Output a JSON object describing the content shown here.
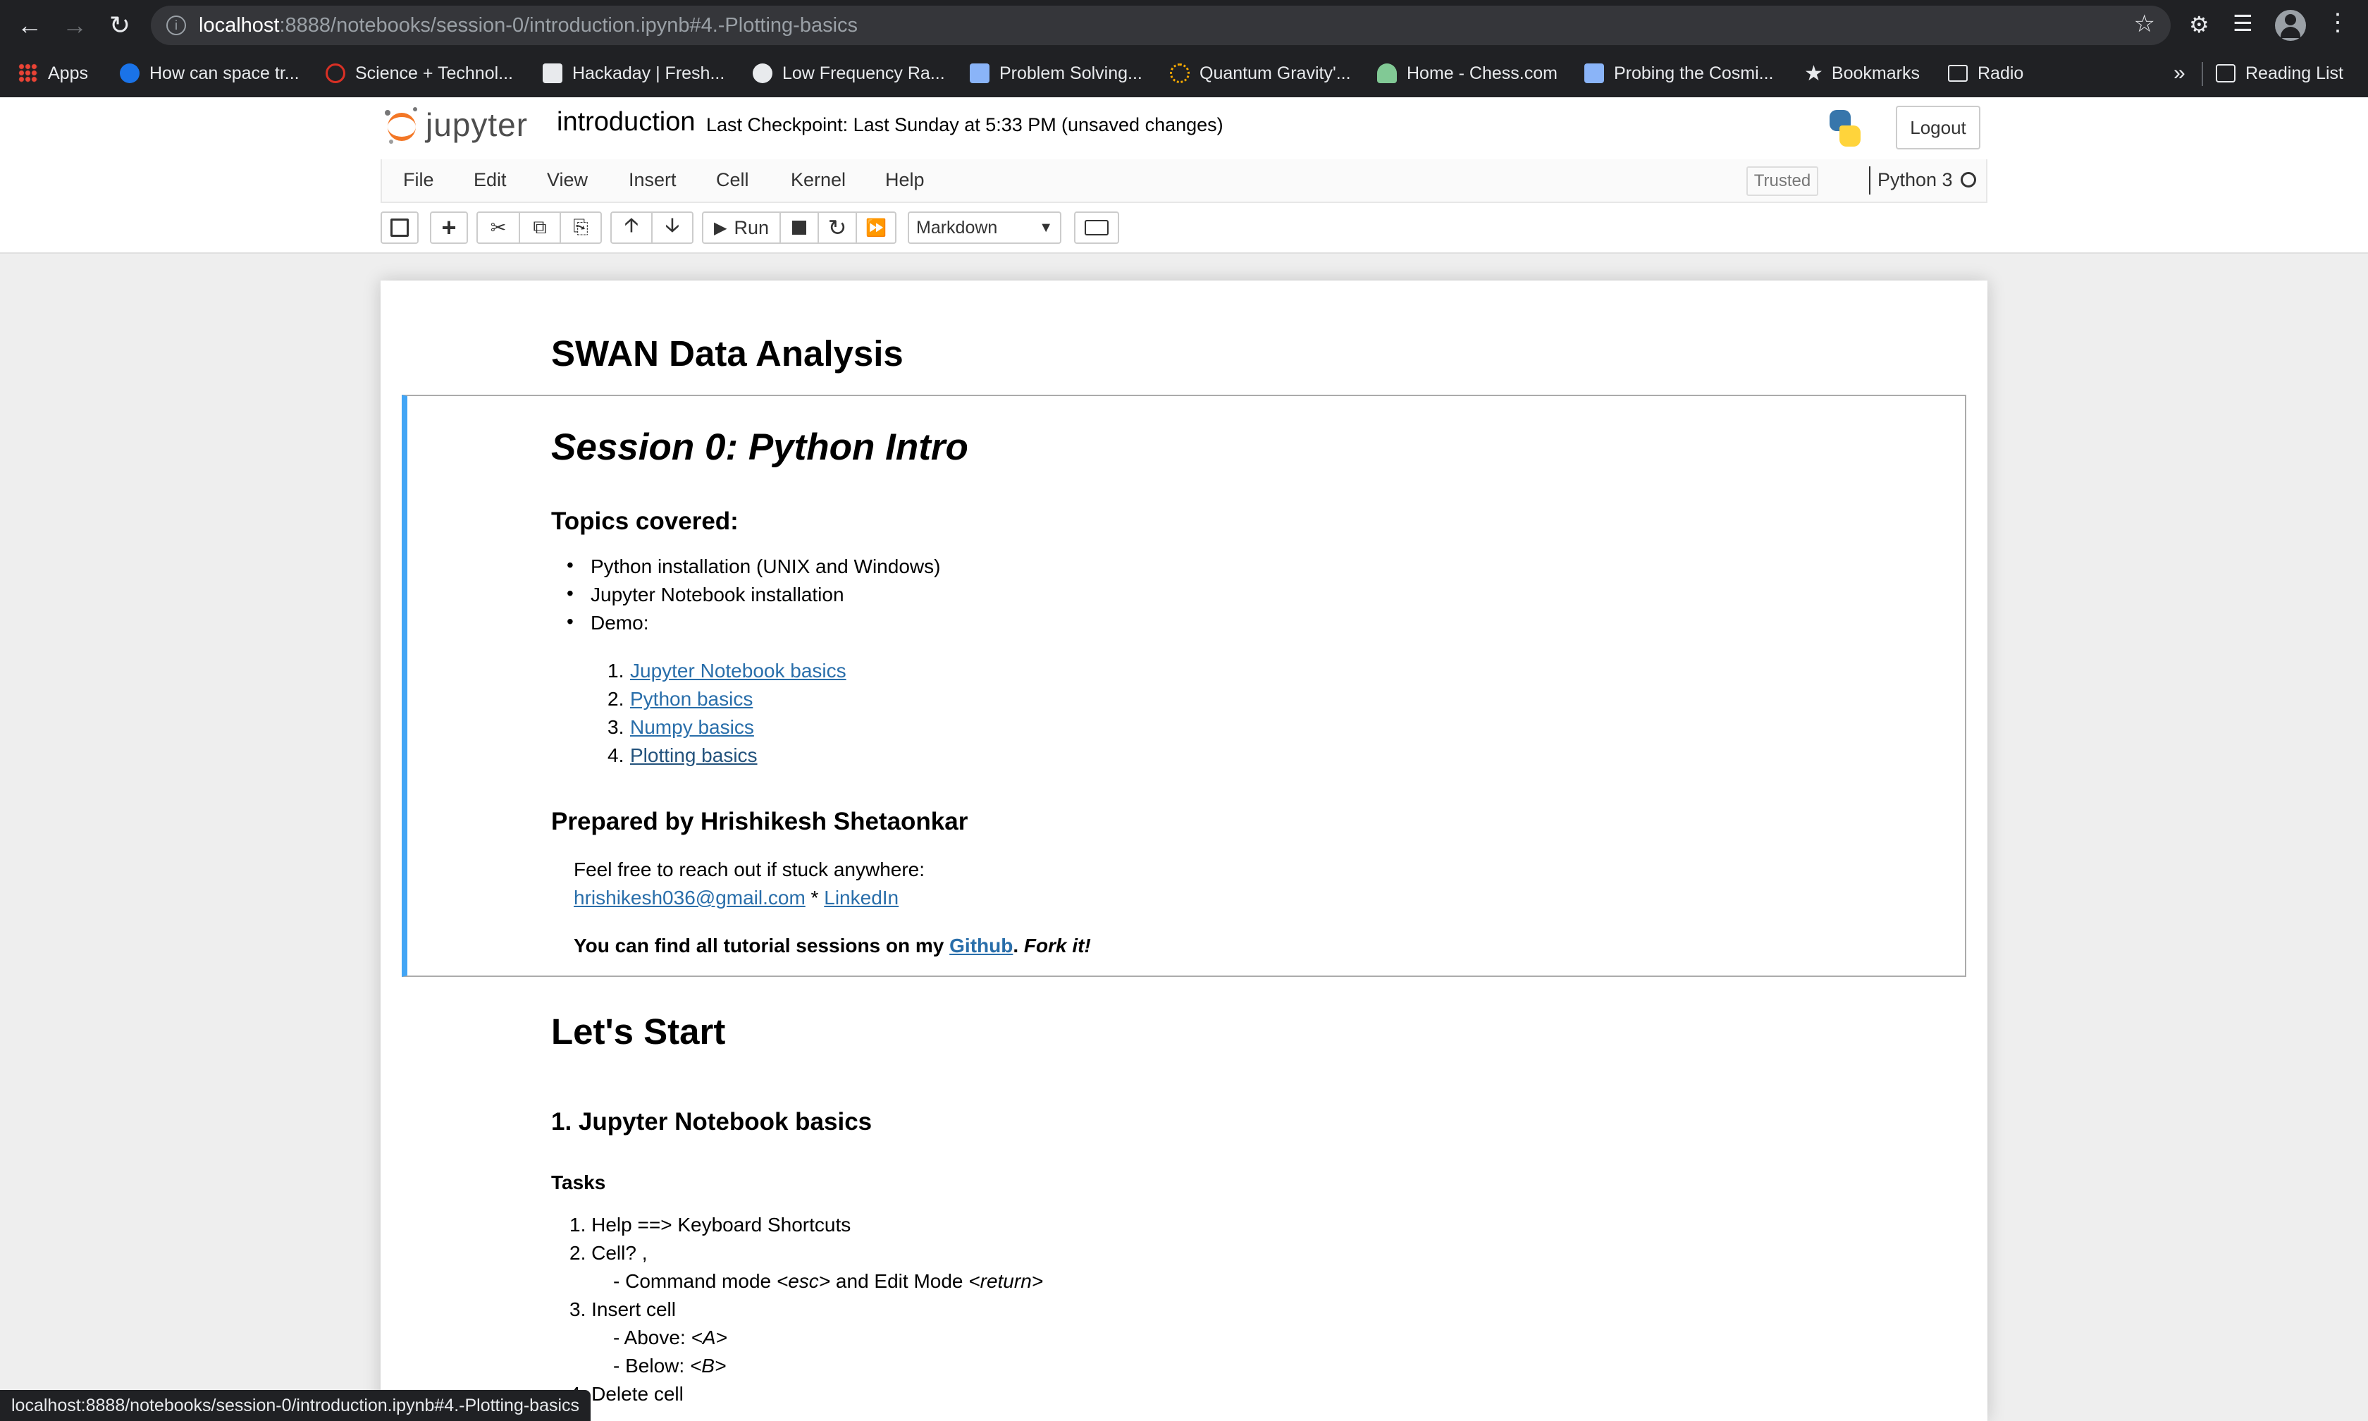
{
  "browser": {
    "url_host": "localhost",
    "url_path": ":8888/notebooks/session-0/introduction.ipynb#4.-Plotting-basics",
    "bookmarks": [
      {
        "label": "Apps",
        "color": "#ea4335"
      },
      {
        "label": "How can space tr...",
        "color": "#1a73e8"
      },
      {
        "label": "Science + Technol...",
        "color": "#d93025"
      },
      {
        "label": "Hackaday | Fresh...",
        "color": "#e8eaed"
      },
      {
        "label": "Low Frequency Ra...",
        "color": "#e8eaed"
      },
      {
        "label": "Problem Solving...",
        "color": "#8ab4f8"
      },
      {
        "label": "Quantum Gravity'...",
        "color": "#f9ab00"
      },
      {
        "label": "Home - Chess.com",
        "color": "#81c995"
      },
      {
        "label": "Probing the Cosmi...",
        "color": "#8ab4f8"
      },
      {
        "label": "Bookmarks",
        "color": "#e8eaed"
      },
      {
        "label": "Radio",
        "color": "#e8eaed"
      }
    ],
    "overflow_label": "»",
    "reading_list": "Reading List",
    "status_url": "localhost:8888/notebooks/session-0/introduction.ipynb#4.-Plotting-basics"
  },
  "jupyter": {
    "logo_text": "jupyter",
    "notebook_name": "introduction",
    "checkpoint": "Last Checkpoint: Last Sunday at 5:33 PM",
    "unsaved": "(unsaved changes)",
    "logout": "Logout",
    "menu": [
      "File",
      "Edit",
      "View",
      "Insert",
      "Cell",
      "Kernel",
      "Help"
    ],
    "trusted": "Trusted",
    "kernel": "Python 3",
    "run_label": "Run",
    "cell_type": "Markdown",
    "accent": "#42a5f5"
  },
  "notebook": {
    "title": "SWAN Data Analysis",
    "session_title": "Session 0: Python Intro",
    "topics_heading": "Topics covered:",
    "topics": [
      "Python installation (UNIX and Windows)",
      "Jupyter Notebook installation",
      "Demo:"
    ],
    "demo_links": [
      "Jupyter Notebook basics",
      "Python basics",
      "Numpy basics",
      "Plotting basics"
    ],
    "prepared_by": "Prepared by Hrishikesh Shetaonkar",
    "reach_out": "Feel free to reach out if stuck anywhere:",
    "email": "hrishikesh036@gmail.com",
    "separator": " * ",
    "linkedin": "LinkedIn",
    "find_text": "You can find all tutorial sessions on my ",
    "github": "Github",
    "fork_text": "Fork it!",
    "lets_start": "Let's Start",
    "section1": "1. Jupyter Notebook basics",
    "tasks": "Tasks",
    "task1": "1. Help ==> Keyboard Shortcuts",
    "task2": "2. Cell? ,",
    "task2_sub_a": "- Command mode ",
    "task2_sub_esc": "<esc>",
    "task2_sub_b": " and Edit Mode ",
    "task2_sub_ret": "<return>",
    "task3": "3. Insert cell",
    "task3_above_a": "- Above: ",
    "task3_above_key": "<A>",
    "task3_below_a": "- Below: ",
    "task3_below_key": "<B>",
    "task4": "4. Delete cell"
  }
}
